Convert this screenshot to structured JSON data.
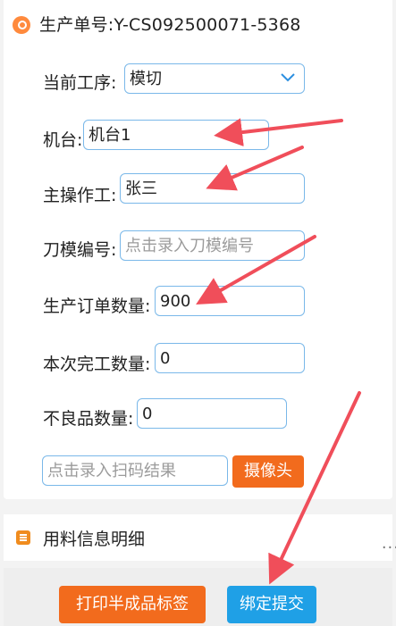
{
  "order": {
    "label": "生产单号:",
    "value": "Y-CS092500071-5368"
  },
  "fields": {
    "process": {
      "label": "当前工序:",
      "value": "模切"
    },
    "machine": {
      "label": "机台:",
      "value": "机台1"
    },
    "operator": {
      "label": "主操作工:",
      "value": "张三"
    },
    "die_no": {
      "label": "刀模编号:",
      "placeholder": "点击录入刀模编号"
    },
    "order_qty": {
      "label": "生产订单数量:",
      "value": "900"
    },
    "done_qty": {
      "label": "本次完工数量:",
      "value": "0"
    },
    "defect_qty": {
      "label": "不良品数量:",
      "value": "0"
    },
    "scan": {
      "placeholder": "点击录入扫码结果"
    }
  },
  "buttons": {
    "camera": "摄像头",
    "print_label": "打印半成品标签",
    "bind_submit": "绑定提交"
  },
  "section": {
    "title": "用料信息明细",
    "more": "..."
  },
  "colors": {
    "accent_orange": "#f26b1d",
    "accent_blue": "#1fa0e6",
    "annotation_arrow": "#f04e5a"
  }
}
